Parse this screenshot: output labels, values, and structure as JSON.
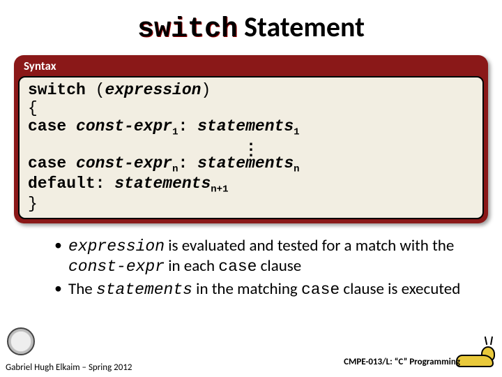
{
  "title": {
    "keyword": "switch",
    "word": "Statement"
  },
  "syntax": {
    "label": "Syntax",
    "code": {
      "l1_kw": "switch",
      "l1_open": " (",
      "l1_expr": "expression",
      "l1_close": ")",
      "l2": "{",
      "l3_indent": "   ",
      "l3_case": "case",
      "l3_sp1": " ",
      "l3_ce": "const-expr",
      "l3_sub1": "1",
      "l3_colon": ":",
      "l3_sp2": " ",
      "l3_stmt": "statements",
      "l3_sub2": "1",
      "dots": ".",
      "l5_indent": "   ",
      "l5_case": "case",
      "l5_sp1": " ",
      "l5_ce": "const-expr",
      "l5_subn": "n",
      "l5_colon": ":",
      "l5_sp2": " ",
      "l5_stmt": "statements",
      "l5_subn2": "n",
      "l6_indent": "   ",
      "l6_def": "default",
      "l6_colon": ":",
      "l6_sp": " ",
      "l6_stmt": "statements",
      "l6_sub": "n+1",
      "l7": "}"
    }
  },
  "bullets": {
    "b1": {
      "t1": "expression",
      "t2": " is evaluated and tested for a match with the ",
      "t3": "const-expr",
      "t4": " in each ",
      "t5": "case",
      "t6": " clause"
    },
    "b2": {
      "t1": "The ",
      "t2": "statements",
      "t3": " in the matching ",
      "t4": "case",
      "t5": " clause is executed"
    }
  },
  "footer": {
    "left": "Gabriel Hugh Elkaim – Spring 2012",
    "right": "CMPE-013/L: “C” Programming"
  }
}
